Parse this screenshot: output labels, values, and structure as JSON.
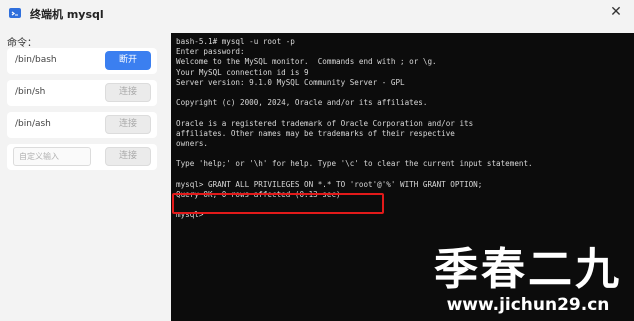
{
  "window": {
    "title": "终端机 mysql",
    "close_symbol": "✕"
  },
  "sidebar": {
    "label": "命令：",
    "items": [
      {
        "label": "/bin/bash",
        "button": "断开"
      },
      {
        "label": "/bin/sh",
        "button": "连接"
      },
      {
        "label": "/bin/ash",
        "button": "连接"
      }
    ],
    "custom": {
      "placeholder": "自定义输入",
      "button": "连接"
    }
  },
  "terminal": {
    "lines": [
      "bash-5.1# mysql -u root -p",
      "Enter password:",
      "Welcome to the MySQL monitor.  Commands end with ; or \\g.",
      "Your MySQL connection id is 9",
      "Server version: 9.1.0 MySQL Community Server - GPL",
      "",
      "Copyright (c) 2000, 2024, Oracle and/or its affiliates.",
      "",
      "Oracle is a registered trademark of Oracle Corporation and/or its",
      "affiliates. Other names may be trademarks of their respective",
      "owners.",
      "",
      "Type 'help;' or '\\h' for help. Type '\\c' to clear the current input statement.",
      "",
      "mysql> GRANT ALL PRIVILEGES ON *.* TO 'root'@'%' WITH GRANT OPTION;",
      "Query OK, 0 rows affected (0.13 sec)",
      "",
      "mysql>"
    ]
  },
  "watermark": {
    "name": "季春二九",
    "url": "www.jichun29.cn"
  },
  "colors": {
    "accent": "#3b7ff0",
    "highlight": "#e21a1a",
    "terminal_bg": "#0c0c0c"
  }
}
